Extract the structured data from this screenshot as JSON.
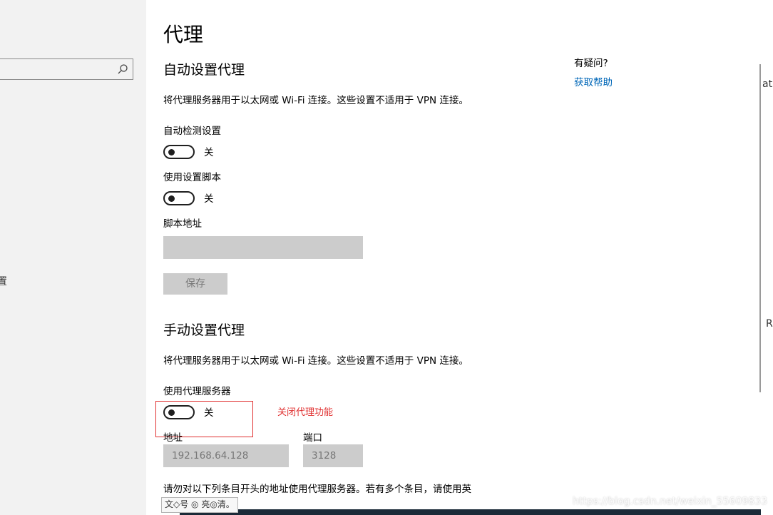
{
  "left_pane": {
    "search": {
      "value": ""
    },
    "partial_text": "置"
  },
  "page": {
    "title": "代理"
  },
  "auto": {
    "title": "自动设置代理",
    "description": "将代理服务器用于以太网或 Wi-Fi 连接。这些设置不适用于 VPN 连接。",
    "detect": {
      "label": "自动检测设置",
      "state": "关"
    },
    "script": {
      "label": "使用设置脚本",
      "state": "关"
    },
    "script_address": {
      "label": "脚本地址",
      "value": ""
    },
    "save_label": "保存"
  },
  "manual": {
    "title": "手动设置代理",
    "description": "将代理服务器用于以太网或 Wi-Fi 连接。这些设置不适用于 VPN 连接。",
    "use_proxy": {
      "label": "使用代理服务器",
      "state": "关"
    },
    "address": {
      "label": "地址",
      "value": "192.168.64.128"
    },
    "port": {
      "label": "端口",
      "value": "3128"
    },
    "exceptions_text": "请勿对以下列条目开头的地址使用代理服务器。若有多个条目，请使用英"
  },
  "annotation": {
    "text": "关闭代理功能",
    "color": "#e03030"
  },
  "help": {
    "question": "有疑问?",
    "link": "获取帮助",
    "link_color": "#0067b8"
  },
  "right_edge": {
    "text_top": "at",
    "text_mid": "R"
  },
  "watermark": "https://blog.csdn.net/weixin_55609833",
  "tooltip": "文◇号 ◎ 亮◎清。"
}
